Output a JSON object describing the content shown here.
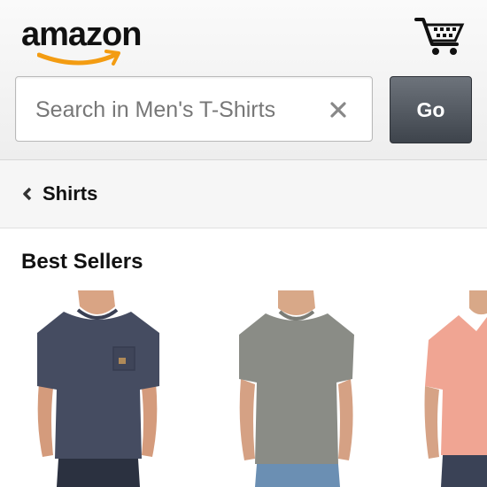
{
  "header": {
    "logo_text": "amazon",
    "logo_icon": "amazon-smile-arrow",
    "cart_icon": "shopping-cart-icon"
  },
  "search": {
    "placeholder": "Search in Men's T-Shirts",
    "value": "",
    "clear_icon": "close-icon",
    "go_label": "Go"
  },
  "breadcrumb": {
    "back_icon": "chevron-left-icon",
    "label": "Shirts"
  },
  "best_sellers": {
    "title": "Best Sellers",
    "products": [
      {
        "image": "navy-pocket-tshirt",
        "shirt_color": "#454c61"
      },
      {
        "image": "gray-crew-tshirt",
        "shirt_color": "#8a8c86"
      },
      {
        "image": "salmon-vneck-tshirt",
        "shirt_color": "#f0a593"
      }
    ]
  },
  "colors": {
    "header_bg": "#f2f2f2",
    "go_button": "#4a5058",
    "logo_arrow": "#f39c12"
  }
}
